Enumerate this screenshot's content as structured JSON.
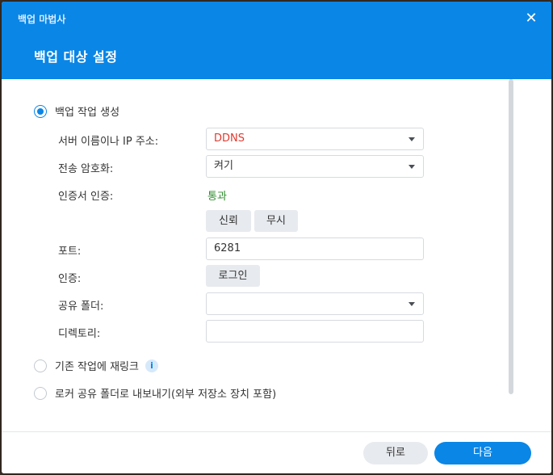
{
  "window": {
    "title": "백업 마법사",
    "close_icon": "close-icon"
  },
  "header": {
    "step_title": "백업 대상 설정"
  },
  "options": {
    "create_task": {
      "label": "백업 작업 생성",
      "selected": true
    },
    "relink_task": {
      "label": "기존 작업에 재링크",
      "info_icon": "i"
    },
    "export_local": {
      "label": "로커 공유 폴더로 내보내기(외부 저장소 장치 포함)"
    }
  },
  "form": {
    "server_label": "서버 이름이나 IP 주소:",
    "server_value": "DDNS",
    "encryption_label": "전송 암호화:",
    "encryption_value": "켜기",
    "cert_label": "인증서 인증:",
    "cert_status": "통과",
    "trust_button": "신뢰",
    "ignore_button": "무시",
    "port_label": "포트:",
    "port_value": "6281",
    "auth_label": "인증:",
    "login_button": "로그인",
    "shared_folder_label": "공유 폴더:",
    "shared_folder_value": "",
    "directory_label": "디렉토리:",
    "directory_value": ""
  },
  "footer": {
    "back_button": "뒤로",
    "next_button": "다음"
  },
  "colors": {
    "accent": "#0a86e6",
    "ddns_text": "#e03a2f",
    "ok_text": "#2e8b2e"
  }
}
